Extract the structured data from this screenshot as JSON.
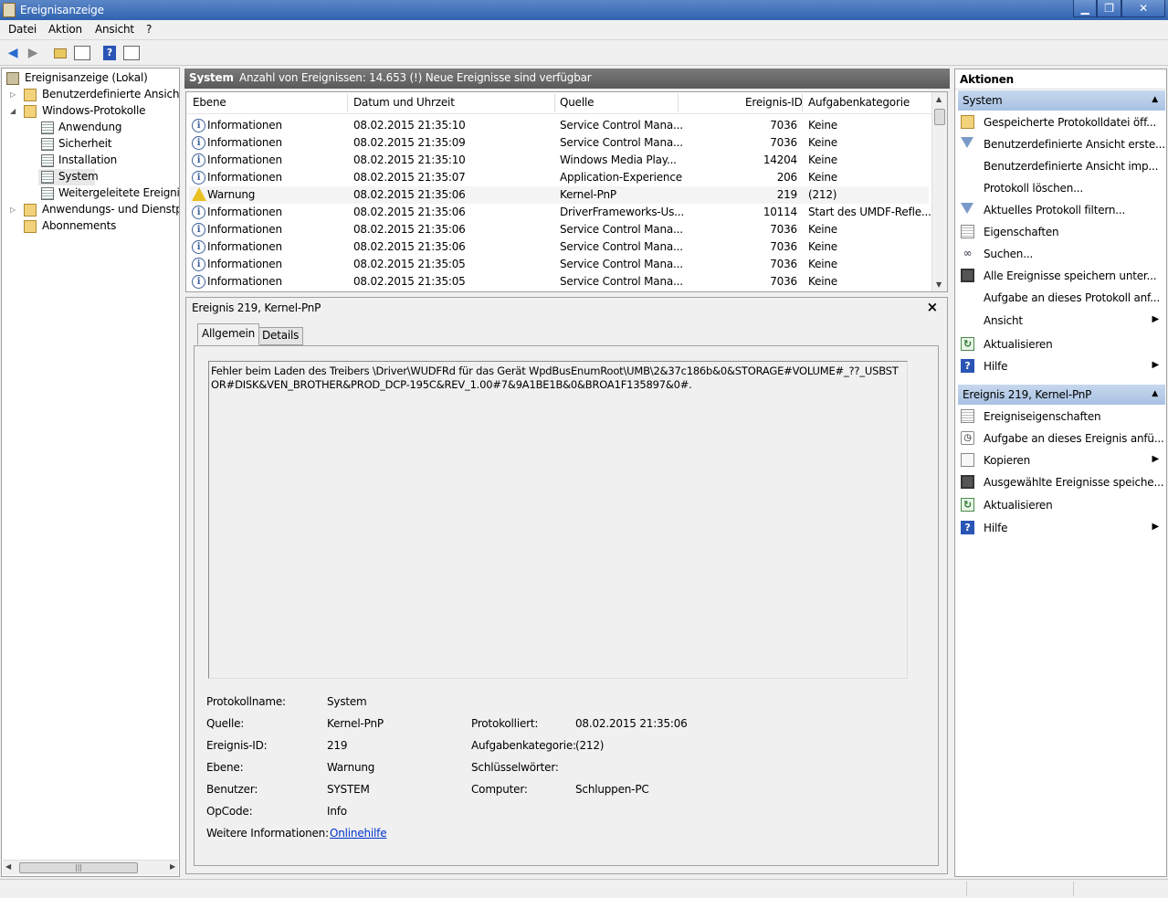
{
  "window": {
    "title": "Ereignisanzeige",
    "btn_min": "▁",
    "btn_max": "❐",
    "btn_close": "✕"
  },
  "menu": [
    "Datei",
    "Aktion",
    "Ansicht",
    "?"
  ],
  "tree": {
    "root": "Ereignisanzeige (Lokal)",
    "custom_views": "Benutzerdefinierte Ansichten",
    "windows_logs": "Windows-Protokolle",
    "app": "Anwendung",
    "security": "Sicherheit",
    "setup": "Installation",
    "system": "System",
    "forwarded": "Weitergeleitete Ereignisse",
    "app_services": "Anwendungs- und Dienstprotokolle",
    "subscriptions": "Abonnements"
  },
  "header": {
    "title": "System",
    "info": "Anzahl von Ereignissen: 14.653 (!) Neue Ereignisse sind verfügbar"
  },
  "columns": {
    "level": "Ebene",
    "date": "Datum und Uhrzeit",
    "source": "Quelle",
    "id": "Ereignis-ID",
    "category": "Aufgabenkategorie"
  },
  "events": [
    {
      "level": "Informationen",
      "date": "08.02.2015 21:35:10",
      "source": "Service Control Mana...",
      "id": "7036",
      "category": "Keine",
      "icon": "info"
    },
    {
      "level": "Informationen",
      "date": "08.02.2015 21:35:09",
      "source": "Service Control Mana...",
      "id": "7036",
      "category": "Keine",
      "icon": "info"
    },
    {
      "level": "Informationen",
      "date": "08.02.2015 21:35:10",
      "source": "Windows Media Play...",
      "id": "14204",
      "category": "Keine",
      "icon": "info"
    },
    {
      "level": "Informationen",
      "date": "08.02.2015 21:35:07",
      "source": "Application-Experience",
      "id": "206",
      "category": "Keine",
      "icon": "info"
    },
    {
      "level": "Warnung",
      "date": "08.02.2015 21:35:06",
      "source": "Kernel-PnP",
      "id": "219",
      "category": "(212)",
      "icon": "warning"
    },
    {
      "level": "Informationen",
      "date": "08.02.2015 21:35:06",
      "source": "DriverFrameworks-Us...",
      "id": "10114",
      "category": "Start des UMDF-Refle...",
      "icon": "info"
    },
    {
      "level": "Informationen",
      "date": "08.02.2015 21:35:06",
      "source": "Service Control Mana...",
      "id": "7036",
      "category": "Keine",
      "icon": "info"
    },
    {
      "level": "Informationen",
      "date": "08.02.2015 21:35:06",
      "source": "Service Control Mana...",
      "id": "7036",
      "category": "Keine",
      "icon": "info"
    },
    {
      "level": "Informationen",
      "date": "08.02.2015 21:35:05",
      "source": "Service Control Mana...",
      "id": "7036",
      "category": "Keine",
      "icon": "info"
    },
    {
      "level": "Informationen",
      "date": "08.02.2015 21:35:05",
      "source": "Service Control Mana...",
      "id": "7036",
      "category": "Keine",
      "icon": "info"
    }
  ],
  "detail": {
    "title": "Ereignis 219, Kernel-PnP",
    "tab_general": "Allgemein",
    "tab_details": "Details",
    "message": "Fehler beim Laden des Treibers \\Driver\\WUDFRd für das Gerät WpdBusEnumRoot\\UMB\\2&37c186b&0&STORAGE#VOLUME#_??_USBSTOR#DISK&VEN_BROTHER&PROD_DCP-195C&REV_1.00#7&9A1BE1B&0&BROA1F135897&0#.",
    "labels": {
      "log_name": "Protokollname:",
      "source": "Quelle:",
      "event_id": "Ereignis-ID:",
      "level": "Ebene:",
      "user": "Benutzer:",
      "opcode": "OpCode:",
      "more_info": "Weitere Informationen:",
      "logged": "Protokolliert:",
      "task_category": "Aufgabenkategorie:",
      "keywords": "Schlüsselwörter:",
      "computer": "Computer:"
    },
    "values": {
      "log_name": "System",
      "source": "Kernel-PnP",
      "event_id": "219",
      "level": "Warnung",
      "user": "SYSTEM",
      "opcode": "Info",
      "more_info": "Onlinehilfe",
      "logged": "08.02.2015 21:35:06",
      "task_category": "(212)",
      "keywords": "",
      "computer": "Schluppen-PC"
    }
  },
  "actions": {
    "title": "Aktionen",
    "section1": "System",
    "items1": [
      {
        "label": "Gespeicherte Protokolldatei öff...",
        "icon": "folder-open-icon"
      },
      {
        "label": "Benutzerdefinierte Ansicht erste...",
        "icon": "filter-icon"
      },
      {
        "label": "Benutzerdefinierte Ansicht imp...",
        "icon": ""
      },
      {
        "label": "Protokoll löschen...",
        "icon": ""
      },
      {
        "label": "Aktuelles Protokoll filtern...",
        "icon": "filter-icon"
      },
      {
        "label": "Eigenschaften",
        "icon": "properties-icon"
      },
      {
        "label": "Suchen...",
        "icon": "binoculars-icon"
      },
      {
        "label": "Alle Ereignisse speichern unter...",
        "icon": "save-icon"
      },
      {
        "label": "Aufgabe an dieses Protokoll anf...",
        "icon": ""
      },
      {
        "label": "Ansicht",
        "icon": "",
        "submenu": true
      },
      {
        "label": "Aktualisieren",
        "icon": "refresh-icon"
      },
      {
        "label": "Hilfe",
        "icon": "help-icon",
        "submenu": true
      }
    ],
    "section2": "Ereignis 219, Kernel-PnP",
    "items2": [
      {
        "label": "Ereigniseigenschaften",
        "icon": "properties-icon"
      },
      {
        "label": "Aufgabe an dieses Ereignis anfü...",
        "icon": "task-icon"
      },
      {
        "label": "Kopieren",
        "icon": "copy-icon",
        "submenu": true
      },
      {
        "label": "Ausgewählte Ereignisse speiche...",
        "icon": "save-icon"
      },
      {
        "label": "Aktualisieren",
        "icon": "refresh-icon"
      },
      {
        "label": "Hilfe",
        "icon": "help-icon",
        "submenu": true
      }
    ]
  }
}
